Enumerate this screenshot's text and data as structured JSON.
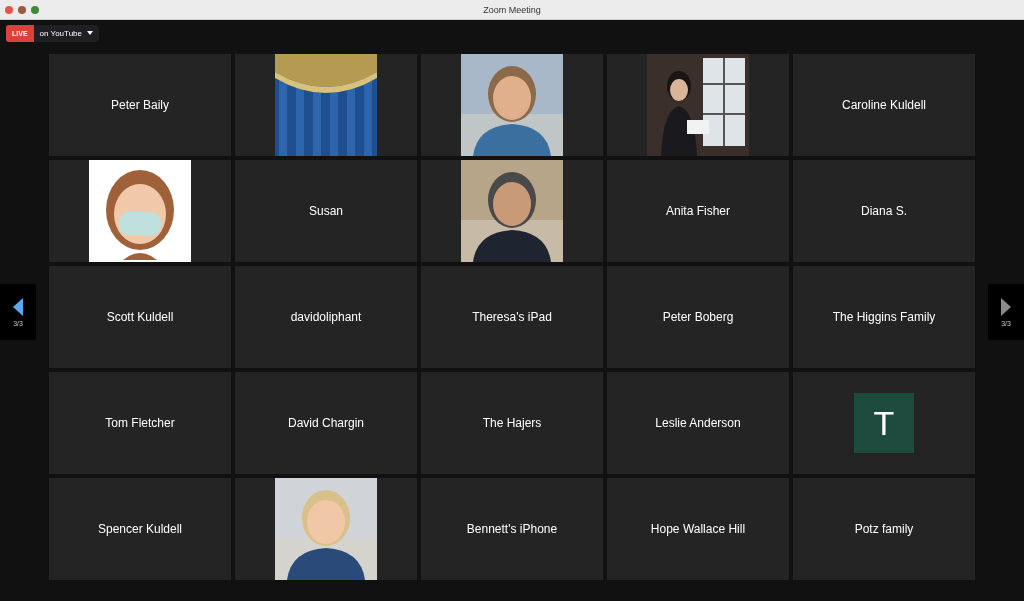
{
  "window": {
    "title": "Zoom Meeting"
  },
  "toolbar": {
    "live_badge": "LIVE",
    "stream_target": "on YouTube"
  },
  "nav": {
    "prev": {
      "page": "3/3",
      "enabled": true
    },
    "next": {
      "page": "3/3",
      "enabled": false
    }
  },
  "tiles": [
    {
      "kind": "name",
      "name": "Peter Baily"
    },
    {
      "kind": "picture"
    },
    {
      "kind": "picture"
    },
    {
      "kind": "picture"
    },
    {
      "kind": "name",
      "name": "Caroline Kuldell"
    },
    {
      "kind": "picture"
    },
    {
      "kind": "name",
      "name": "Susan"
    },
    {
      "kind": "picture"
    },
    {
      "kind": "name",
      "name": "Anita Fisher"
    },
    {
      "kind": "name",
      "name": "Diana S."
    },
    {
      "kind": "name",
      "name": "Scott Kuldell"
    },
    {
      "kind": "name",
      "name": "davidoliphant"
    },
    {
      "kind": "name",
      "name": "Theresa's iPad"
    },
    {
      "kind": "name",
      "name": "Peter Boberg"
    },
    {
      "kind": "name",
      "name": "The Higgins Family"
    },
    {
      "kind": "name",
      "name": "Tom Fletcher"
    },
    {
      "kind": "name",
      "name": "David Chargin"
    },
    {
      "kind": "name",
      "name": "The Hajers"
    },
    {
      "kind": "name",
      "name": "Leslie Anderson"
    },
    {
      "kind": "letter",
      "letter": "T",
      "color": "#1f4a3e"
    },
    {
      "kind": "name",
      "name": "Spencer Kuldell"
    },
    {
      "kind": "picture"
    },
    {
      "kind": "name",
      "name": "Bennett's iPhone"
    },
    {
      "kind": "name",
      "name": "Hope Wallace Hill"
    },
    {
      "kind": "name",
      "name": "Potz family"
    }
  ]
}
